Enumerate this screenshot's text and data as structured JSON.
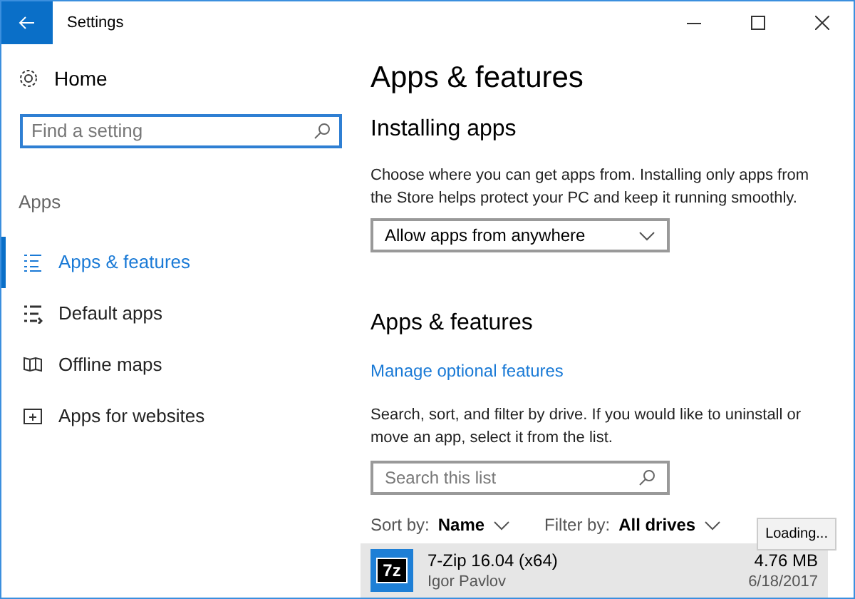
{
  "window": {
    "title": "Settings"
  },
  "sidebar": {
    "home": "Home",
    "search": {
      "placeholder": "Find a setting"
    },
    "section": "Apps",
    "items": [
      {
        "label": "Apps & features",
        "selected": true,
        "kind": "list"
      },
      {
        "label": "Default apps",
        "selected": false,
        "kind": "defaults"
      },
      {
        "label": "Offline maps",
        "selected": false,
        "kind": "map"
      },
      {
        "label": "Apps for websites",
        "selected": false,
        "kind": "web"
      }
    ]
  },
  "content": {
    "title": "Apps & features",
    "installing": {
      "heading": "Installing apps",
      "description": "Choose where you can get apps from. Installing only apps from the Store helps protect your PC and keep it running smoothly.",
      "dropdown": "Allow apps from anywhere"
    },
    "apps": {
      "heading": "Apps & features",
      "link": "Manage optional features",
      "description": "Search, sort, and filter by drive. If you would like to uninstall or move an app, select it from the list.",
      "search": {
        "placeholder": "Search this list"
      },
      "sort_label": "Sort by:",
      "sort_value": "Name",
      "filter_label": "Filter by:",
      "filter_value": "All drives",
      "tooltip": "Loading...",
      "list": [
        {
          "icon_text": "7z",
          "name": "7-Zip 16.04 (x64)",
          "publisher": "Igor Pavlov",
          "size": "4.76 MB",
          "date": "6/18/2017",
          "selected": true
        }
      ]
    }
  }
}
